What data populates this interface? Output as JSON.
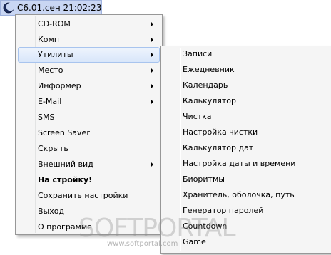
{
  "clock": {
    "text": "С6.01.сен 21:02:23",
    "icon": "moon-icon"
  },
  "main_menu": {
    "items": [
      {
        "label": "CD-ROM",
        "submenu": true
      },
      {
        "label": "Комп",
        "submenu": true
      },
      {
        "label": "Утилиты",
        "submenu": true,
        "highlighted": true
      },
      {
        "label": "Место",
        "submenu": true
      },
      {
        "label": "Информер",
        "submenu": true
      },
      {
        "label": "E-Mail",
        "submenu": true
      },
      {
        "label": "SMS",
        "submenu": false
      },
      {
        "label": "Screen Saver",
        "submenu": false
      },
      {
        "label": "Скрыть",
        "submenu": false
      },
      {
        "label": "Внешний вид",
        "submenu": true
      },
      {
        "label": "На стройку!",
        "submenu": false,
        "bold": true
      },
      {
        "label": "Сохранить настройки",
        "submenu": false
      },
      {
        "label": "Выход",
        "submenu": false
      },
      {
        "label": "О программе",
        "submenu": false
      }
    ]
  },
  "sub_menu": {
    "items": [
      {
        "label": "Записи"
      },
      {
        "label": "Ежедневник"
      },
      {
        "label": "Календарь"
      },
      {
        "label": "Калькулятор"
      },
      {
        "label": "Чистка"
      },
      {
        "label": "Настройка чистки"
      },
      {
        "label": "Калькулятор дат"
      },
      {
        "label": "Настройка даты и времени"
      },
      {
        "label": "Биоритмы"
      },
      {
        "label": "Хранитель, оболочка, путь"
      },
      {
        "label": "Генератор паролей"
      },
      {
        "label": "Countdown"
      },
      {
        "label": "Game"
      }
    ]
  },
  "watermark": {
    "logo": "SOFTPORTAL",
    "url": "www.softportal.com"
  },
  "colors": {
    "menu_background": "#f5f5f5",
    "highlight": "#d8e6fa",
    "clock_background": "#c9d6f3"
  }
}
